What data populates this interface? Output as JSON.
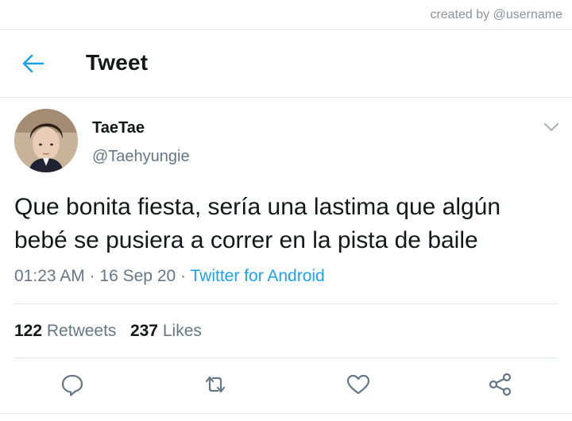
{
  "credit": "created by @username",
  "header": {
    "title": "Tweet"
  },
  "tweet": {
    "display_name": "TaeTae",
    "handle": "@Taehyungie",
    "text": "Que bonita fiesta, sería una lastima que algún\nbebé se pusiera a correr en la pista de baile",
    "time": "01:23 AM",
    "date": "16 Sep 20",
    "separator": "·",
    "source": "Twitter for Android"
  },
  "stats": {
    "retweets_count": "122",
    "retweets_label": "Retweets",
    "likes_count": "237",
    "likes_label": "Likes"
  },
  "colors": {
    "accent": "#1da1f2",
    "text": "#14171a",
    "secondary": "#657786",
    "border": "#e1e8ed"
  },
  "icons": {
    "back": "arrow-left-icon",
    "caret": "chevron-down-icon",
    "reply": "reply-icon",
    "retweet": "retweet-icon",
    "like": "heart-icon",
    "share": "share-icon"
  }
}
